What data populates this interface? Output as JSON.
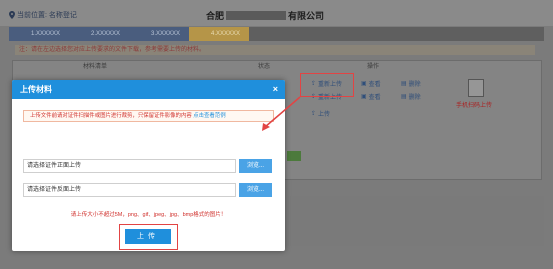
{
  "background": {
    "location_label": "当前位置: 名称登记",
    "company_prefix": "合肥",
    "company_suffix": "有限公司",
    "steps": [
      "1.XXXXXX",
      "2.XXXXXX",
      "3.XXXXXX",
      "4.XXXXXX"
    ],
    "notice": "注：请在左边选择您对应上传要求的文件下载，参考需要上传的材料。",
    "table_headers": {
      "name": "材料清单",
      "status": "状态",
      "action": "操作"
    },
    "row_actions": {
      "reupload": "重新上传",
      "view": "查看",
      "delete": "删除",
      "upload": "上传"
    },
    "phone_upload": "手机扫码上传"
  },
  "modal": {
    "title": "上传材料",
    "close_glyph": "×",
    "tip_text": "上传文件前请对证件扫描件或图片进行裁剪，只保留证件影像的内容",
    "tip_link": "点击查看范例",
    "front_placeholder": "请选择证件正面上传",
    "back_placeholder": "请选择证件反面上传",
    "browse_label": "浏览...",
    "limit_text": "请上传大小不超过5M，png、gif、jpeg、jpg、bmp格式的图片！",
    "upload_label": "上传"
  },
  "colors": {
    "header_blue": "#1f8fdc",
    "highlight_red": "#e24444",
    "warning_red": "#d0312d"
  },
  "icons": {
    "location": "location-pin-icon",
    "close": "close-icon",
    "upload": "upload-icon",
    "view": "view-icon",
    "delete": "delete-icon",
    "qr": "qr-code-icon"
  }
}
